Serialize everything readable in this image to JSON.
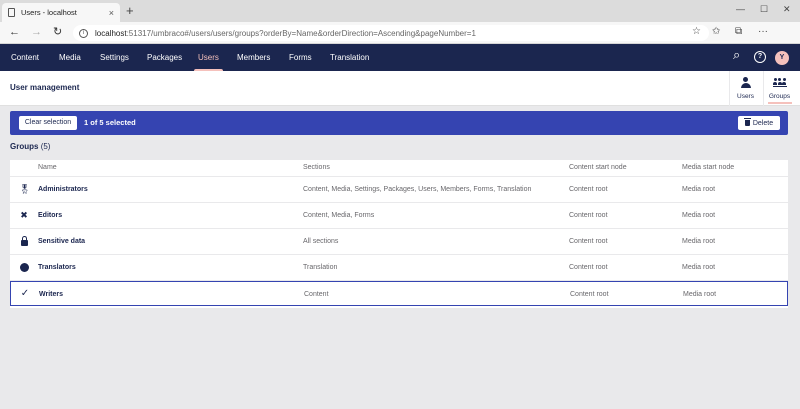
{
  "browser": {
    "tab_title": "Users - localhost",
    "tab_close": "×",
    "new_tab": "+",
    "url_host": "localhost",
    "url_rest": ":51317/umbraco#/users/users/groups?orderBy=Name&orderDirection=Ascending&pageNumber=1",
    "window_controls": [
      "—",
      "☐",
      "✕"
    ],
    "back": "←",
    "forward": "→",
    "reload": "↻",
    "star": "☆",
    "favorites": "✩",
    "collections": "⧉",
    "more": "···",
    "info": "i"
  },
  "header": {
    "sections": [
      "Content",
      "Media",
      "Settings",
      "Packages",
      "Users",
      "Members",
      "Forms",
      "Translation"
    ],
    "active_section": "Users",
    "search_icon": "⌕",
    "help_icon": "?",
    "avatar_initial": "Y"
  },
  "subheader": {
    "title": "User management",
    "apps": [
      {
        "label": "Users",
        "icon": "user-icon"
      },
      {
        "label": "Groups",
        "icon": "users-icon",
        "active": true
      }
    ]
  },
  "selection": {
    "clear_label": "Clear selection",
    "count_text": "1 of 5 selected",
    "delete_label": "Delete"
  },
  "groups": {
    "heading": "Groups",
    "count": "(5)"
  },
  "table": {
    "columns": [
      "Name",
      "Sections",
      "Content start node",
      "Media start node"
    ],
    "rows": [
      {
        "icon": "medal-icon",
        "name": "Administrators",
        "sections": "Content, Media, Settings, Packages, Users, Members, Forms, Translation",
        "content_start": "Content root",
        "media_start": "Media root"
      },
      {
        "icon": "tools-icon",
        "name": "Editors",
        "sections": "Content, Media, Forms",
        "content_start": "Content root",
        "media_start": "Media root"
      },
      {
        "icon": "lock-icon",
        "name": "Sensitive data",
        "sections": "All sections",
        "content_start": "Content root",
        "media_start": "Media root"
      },
      {
        "icon": "globe-icon",
        "name": "Translators",
        "sections": "Translation",
        "content_start": "Content root",
        "media_start": "Media root"
      },
      {
        "icon": "checkmark-icon",
        "name": "Writers",
        "sections": "Content",
        "content_start": "Content root",
        "media_start": "Media root",
        "selected": true
      }
    ]
  },
  "colors": {
    "header_bg": "#1b264f",
    "selection_bar": "#3544b1",
    "accent_pink": "#f5c1bc",
    "page_bg": "#e9e9eb"
  }
}
